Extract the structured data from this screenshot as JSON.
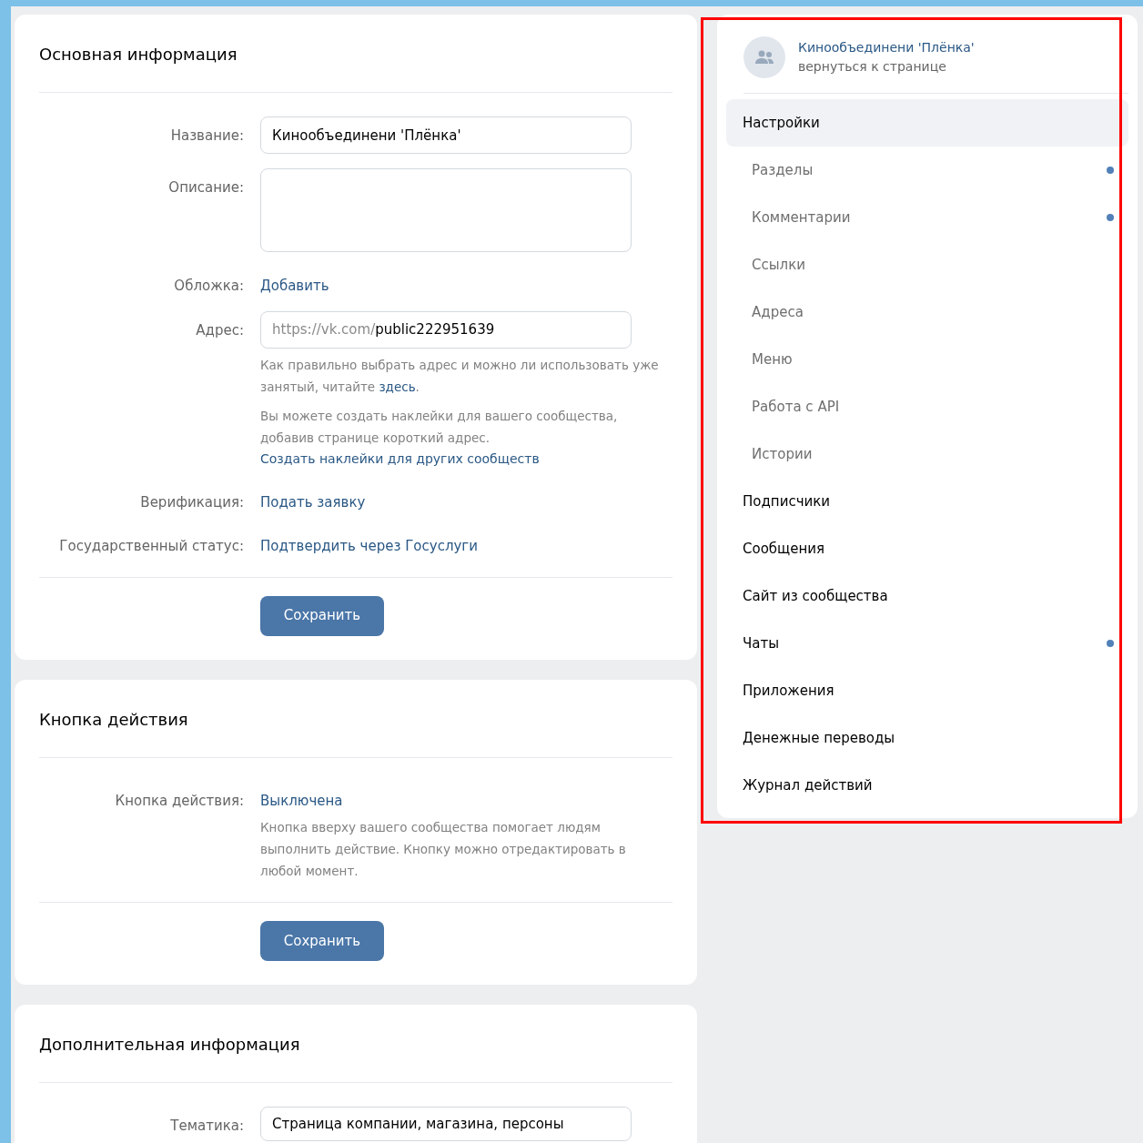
{
  "sections": [
    {
      "title": "Основная информация",
      "rows": [
        {
          "kind": "input",
          "label": "Название:",
          "value": "Кинообъединени 'Плёнка'"
        },
        {
          "kind": "textarea",
          "label": "Описание:",
          "value": ""
        },
        {
          "kind": "link",
          "label": "Обложка:",
          "value": "Добавить"
        },
        {
          "kind": "address",
          "label": "Адрес:",
          "prefix": "https://vk.com/",
          "value": "public222951639",
          "notes": [
            "Как правильно выбрать адрес и можно ли использовать уже занятый, читайте **здесь**.",
            "Вы можете создать наклейки для вашего сообщества, добавив странице короткий адрес."
          ],
          "note_link": "Создать наклейки для других сообществ"
        },
        {
          "kind": "link",
          "label": "Верификация:",
          "value": "Подать заявку"
        },
        {
          "kind": "link",
          "label": "Государственный статус:",
          "value": "Подтвердить через Госуслуги"
        }
      ],
      "button": "Сохранить"
    },
    {
      "title": "Кнопка действия",
      "rows": [
        {
          "kind": "text",
          "label": "Кнопка действия:",
          "value": "Выключена",
          "notes": [
            "Кнопка вверху вашего сообщества помогает людям выполнить действие. Кнопку можно отредактировать в любой момент."
          ]
        }
      ],
      "button": "Сохранить"
    },
    {
      "title": "Дополнительная информация",
      "rows": [
        {
          "kind": "select",
          "label": "Тематика:",
          "value": "Страница компании, магазина, персоны"
        }
      ]
    }
  ],
  "sidebar": {
    "community": {
      "name": "Кинообъединени 'Плёнка'",
      "back_link": "вернуться к странице"
    },
    "items": [
      {
        "label": "Настройки",
        "selected": true,
        "badge": false,
        "children": [
          {
            "label": "Разделы",
            "selected": false,
            "badge": true
          },
          {
            "label": "Комментарии",
            "selected": false,
            "badge": true
          },
          {
            "label": "Ссылки",
            "selected": false,
            "badge": false
          },
          {
            "label": "Адреса",
            "selected": false,
            "badge": false
          },
          {
            "label": "Меню",
            "selected": false,
            "badge": false
          },
          {
            "label": "Работа с API",
            "selected": false,
            "badge": false
          },
          {
            "label": "Истории",
            "selected": false,
            "badge": false
          }
        ]
      },
      {
        "label": "Подписчики",
        "selected": false,
        "badge": false
      },
      {
        "label": "Сообщения",
        "selected": false,
        "badge": false
      },
      {
        "label": "Сайт из сообщества",
        "selected": false,
        "badge": false
      },
      {
        "label": "Чаты",
        "selected": false,
        "badge": true
      },
      {
        "label": "Приложения",
        "selected": false,
        "badge": false
      },
      {
        "label": "Денежные переводы",
        "selected": false,
        "badge": false
      },
      {
        "label": "Журнал действий",
        "selected": false,
        "badge": false
      }
    ]
  }
}
